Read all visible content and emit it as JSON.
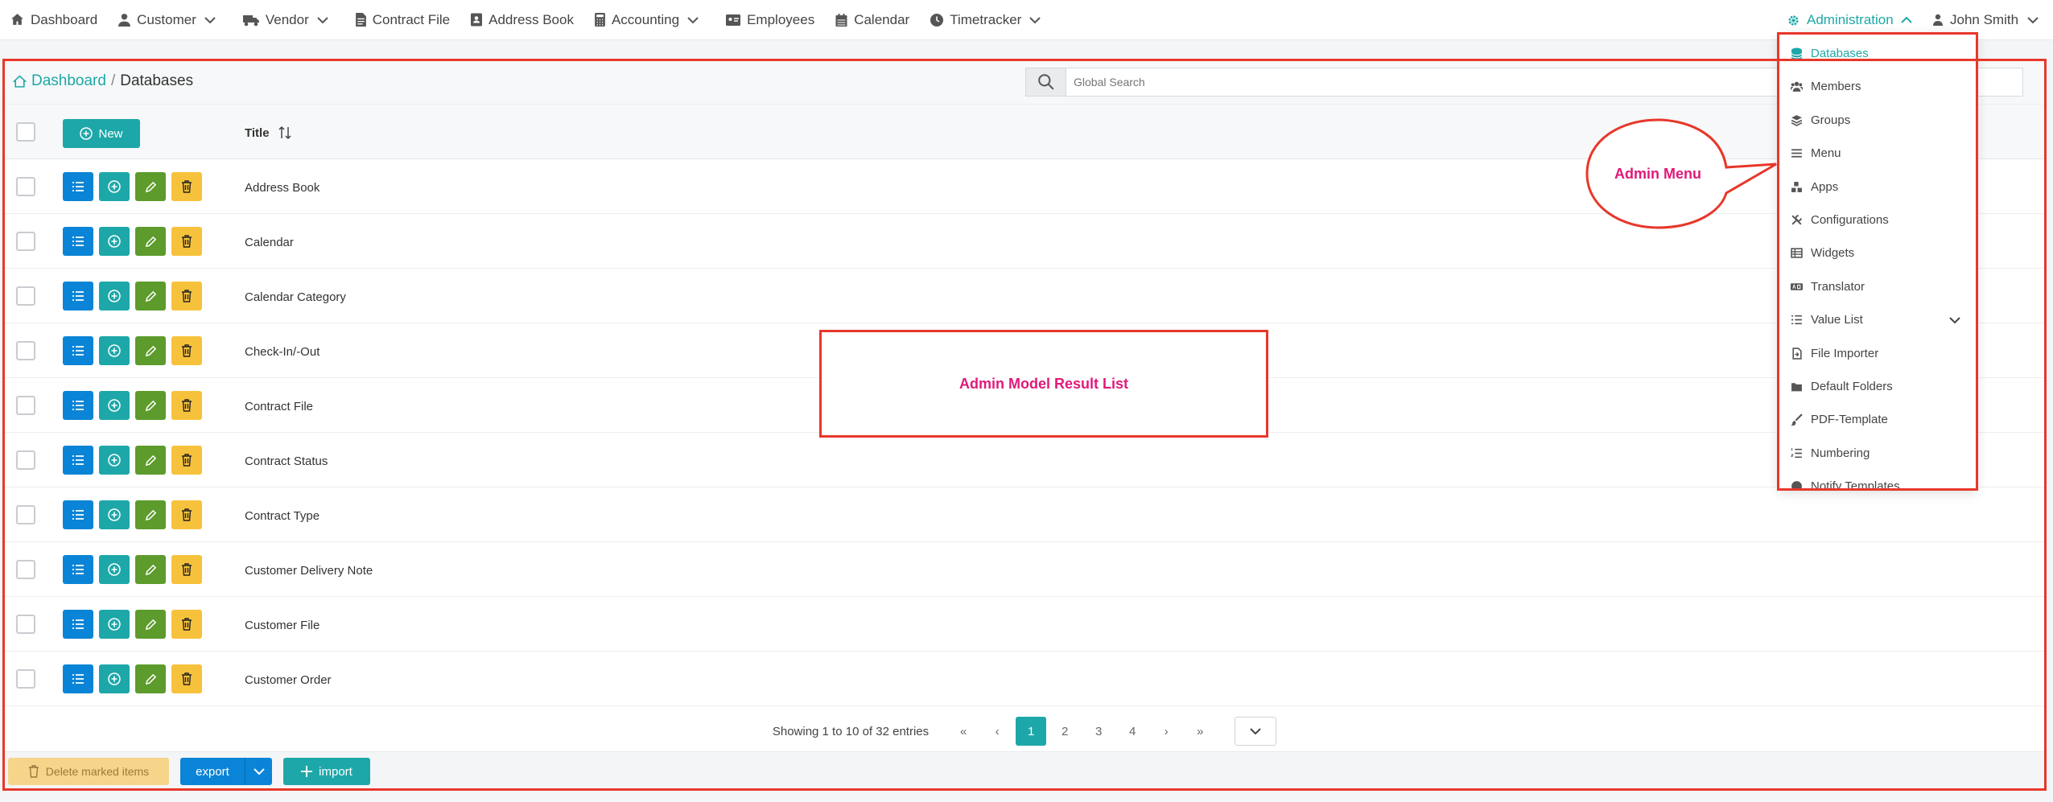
{
  "nav": {
    "items": [
      {
        "label": "Dashboard",
        "icon": "home-icon",
        "caret": false
      },
      {
        "label": "Customer",
        "icon": "user-icon",
        "caret": true
      },
      {
        "label": "Vendor",
        "icon": "truck-icon",
        "caret": true
      },
      {
        "label": "Contract File",
        "icon": "file-icon",
        "caret": false
      },
      {
        "label": "Address Book",
        "icon": "address-book-icon",
        "caret": false
      },
      {
        "label": "Accounting",
        "icon": "calculator-icon",
        "caret": true
      },
      {
        "label": "Employees",
        "icon": "id-card-icon",
        "caret": false
      },
      {
        "label": "Calendar",
        "icon": "calendar-icon",
        "caret": false
      },
      {
        "label": "Timetracker",
        "icon": "clock-icon",
        "caret": true
      }
    ],
    "admin_label": "Administration",
    "user_name": "John Smith"
  },
  "breadcrumb": {
    "home": "Dashboard",
    "separator": "/",
    "current": "Databases"
  },
  "search": {
    "placeholder": "Global Search"
  },
  "table": {
    "new_label": "New",
    "title_header": "Title",
    "rows": [
      {
        "title": "Address Book"
      },
      {
        "title": "Calendar"
      },
      {
        "title": "Calendar Category"
      },
      {
        "title": "Check-In/-Out"
      },
      {
        "title": "Contract File"
      },
      {
        "title": "Contract Status"
      },
      {
        "title": "Contract Type"
      },
      {
        "title": "Customer Delivery Note"
      },
      {
        "title": "Customer File"
      },
      {
        "title": "Customer Order"
      }
    ]
  },
  "pagination": {
    "info": "Showing 1 to 10 of 32 entries",
    "first": "«",
    "prev": "‹",
    "pages": [
      "1",
      "2",
      "3",
      "4"
    ],
    "next": "›",
    "last": "»",
    "active_page": "1"
  },
  "footer": {
    "delete_label": "Delete marked items",
    "export_label": "export",
    "import_label": "import"
  },
  "admin_menu": {
    "items": [
      {
        "label": "Databases",
        "icon": "database-icon",
        "active": true
      },
      {
        "label": "Members",
        "icon": "users-icon"
      },
      {
        "label": "Groups",
        "icon": "layers-icon"
      },
      {
        "label": "Menu",
        "icon": "menu-icon"
      },
      {
        "label": "Apps",
        "icon": "apps-icon"
      },
      {
        "label": "Configurations",
        "icon": "tools-icon"
      },
      {
        "label": "Widgets",
        "icon": "table-icon"
      },
      {
        "label": "Translator",
        "icon": "translate-icon"
      },
      {
        "label": "Value List",
        "icon": "list-icon",
        "chevron": true
      },
      {
        "label": "File Importer",
        "icon": "file-import-icon"
      },
      {
        "label": "Default Folders",
        "icon": "folder-icon"
      },
      {
        "label": "PDF-Template",
        "icon": "brush-icon"
      },
      {
        "label": "Numbering",
        "icon": "numbered-list-icon"
      },
      {
        "label": "Notify Templates",
        "icon": "notify-icon"
      }
    ]
  },
  "annotations": {
    "admin_menu_label": "Admin Menu",
    "result_list_label": "Admin Model Result List"
  },
  "colors": {
    "accent": "#1ea7a8",
    "list_button": "#0a84d6",
    "edit_button": "#5d9b2c",
    "delete_button": "#f7c23b",
    "annotation_border": "#e8372a",
    "annotation_text": "#e0197a"
  }
}
